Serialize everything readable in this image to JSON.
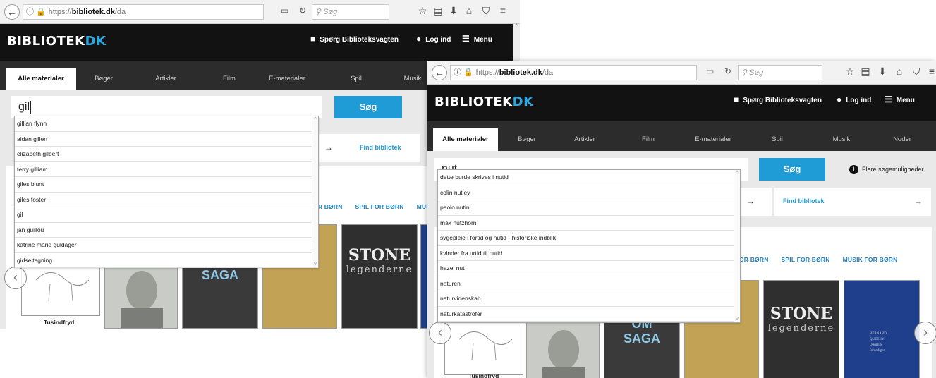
{
  "browser": {
    "url_prefix": "https://",
    "url_domain": "bibliotek.dk",
    "url_path": "/da",
    "search_placeholder": "Søg"
  },
  "site": {
    "logo_main": "BIBLIOTEK",
    "logo_accent": "DK",
    "ask_librarian": "Spørg Biblioteksvagten",
    "login": "Log ind",
    "menu": "Menu"
  },
  "tabs": [
    "Alle materialer",
    "Bøger",
    "Artikler",
    "Film",
    "E-materialer",
    "Spil",
    "Musik",
    "Noder"
  ],
  "search_button": "Søg",
  "more_options": "Flere søgemuligheder",
  "find_library": "Find bibliotek",
  "category_links": [
    "OR BØRN",
    "SPIL FOR BØRN",
    "MUSIK FOR BØRN"
  ],
  "category_links_a": [
    "OR BØRN",
    "SPIL FOR BØRN",
    "MUSIK F"
  ],
  "book_caption": "Tusindfryd",
  "covers": {
    "om_saga": [
      "OM",
      "SAGA"
    ],
    "stone": [
      "STONE",
      "legenderne"
    ],
    "bernard": [
      "BERNARD",
      "QUEENY",
      "Dødelige",
      "forundiger"
    ]
  },
  "window_a": {
    "query": "gil",
    "suggestions": [
      "gillian flynn",
      "aidan gillen",
      "elizabeth gilbert",
      "terry gilliam",
      "giles blunt",
      "giles foster",
      "gil",
      "jan guillou",
      "katrine marie guldager",
      "gidseltagning"
    ]
  },
  "window_b": {
    "query": "nut",
    "suggestions": [
      "dette burde skrives i nutid",
      "colin nutley",
      "paolo nutini",
      "max nutzhorn",
      "sygepleje i fortid og nutid - historiske indblik",
      "kvinder fra urtid til nutid",
      "hazel nut",
      "naturen",
      "naturvidenskab",
      "naturkatastrofer"
    ]
  },
  "colors": {
    "accent": "#1f9bd6",
    "header": "#121212",
    "tabbar": "#2c2c2c"
  }
}
